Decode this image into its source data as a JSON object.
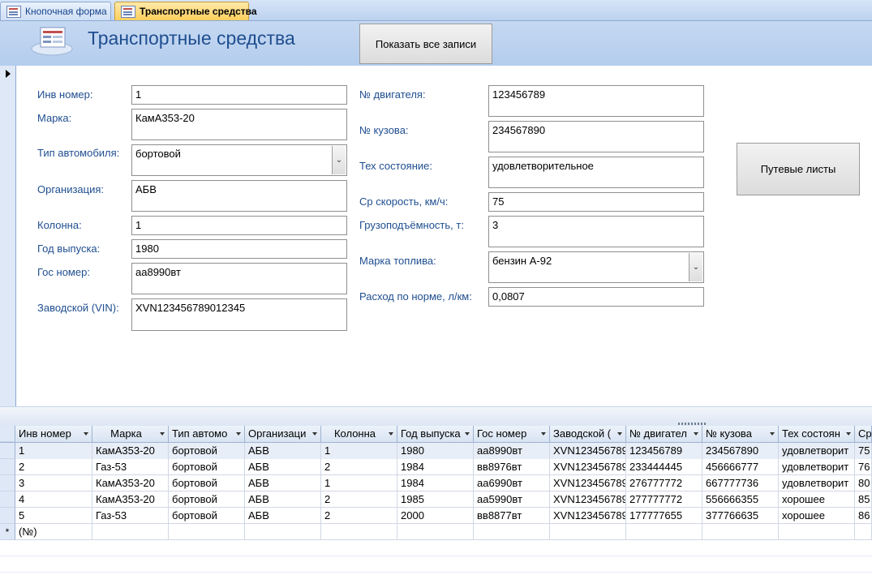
{
  "tabs": [
    {
      "label": "Кнопочная форма",
      "active": false
    },
    {
      "label": "Транспортные средства",
      "active": true
    }
  ],
  "header": {
    "title": "Транспортные средства",
    "show_all_button": "Показать все записи"
  },
  "form": {
    "inv_label": "Инв номер:",
    "inv_value": "1",
    "brand_label": "Марка:",
    "brand_value": "КамА353-20",
    "type_label": "Тип автомобиля:",
    "type_value": "бортовой",
    "org_label": "Организация:",
    "org_value": "АБВ",
    "column_label": "Колонна:",
    "column_value": "1",
    "year_label": "Год выпуска:",
    "year_value": "1980",
    "plate_label": "Гос номер:",
    "plate_value": "аа8990вт",
    "vin_label": "Заводской (VIN):",
    "vin_value": "XVN123456789012345",
    "engine_label": "№ двигателя:",
    "engine_value": "123456789",
    "body_label": "№ кузова:",
    "body_value": "234567890",
    "condition_label": "Тех состояние:",
    "condition_value": "удовлетворительное",
    "speed_label": "Ср скорость, км/ч:",
    "speed_value": "75",
    "capacity_label": "Грузоподъёмность, т:",
    "capacity_value": "3",
    "fuel_label": "Марка топлива:",
    "fuel_value": "бензин А-92",
    "consumption_label": "Расход по норме, л/км:",
    "consumption_value": "0,0807",
    "waybills_button": "Путевые листы"
  },
  "datasheet": {
    "columns": [
      "Инв номер",
      "Марка",
      "Тип автомо",
      "Организаци",
      "Колонна",
      "Год выпуска",
      "Гос номер",
      "Заводской (",
      "№ двигател",
      "№ кузова",
      "Тех состоян",
      "Ср"
    ],
    "rows": [
      [
        "1",
        "КамА353-20",
        "бортовой",
        "АБВ",
        "1",
        "1980",
        "аа8990вт",
        "XVN123456789",
        "123456789",
        "234567890",
        "удовлетворит",
        "75"
      ],
      [
        "2",
        "Газ-53",
        "бортовой",
        "АБВ",
        "2",
        "1984",
        "вв8976вт",
        "XVN123456789",
        "233444445",
        "456666777",
        "удовлетворит",
        "76"
      ],
      [
        "3",
        "КамА353-20",
        "бортовой",
        "АБВ",
        "1",
        "1984",
        "аа6990вт",
        "XVN123456789",
        "276777772",
        "667777736",
        "удовлетворит",
        "80"
      ],
      [
        "4",
        "КамА353-20",
        "бортовой",
        "АБВ",
        "2",
        "1985",
        "аа5990вт",
        "XVN123456789",
        "277777772",
        "556666355",
        "хорошее",
        "85"
      ],
      [
        "5",
        "Газ-53",
        "бортовой",
        "АБВ",
        "2",
        "2000",
        "вв8877вт",
        "XVN123456789",
        "177777655",
        "377766635",
        "хорошее",
        "86"
      ]
    ],
    "new_row_marker": "*",
    "new_row_placeholder": "(№)"
  }
}
